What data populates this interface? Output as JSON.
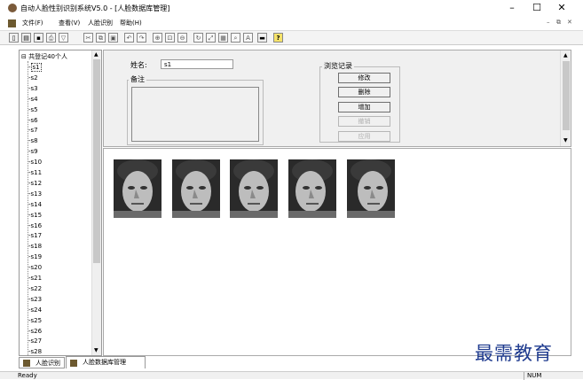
{
  "window": {
    "title": "自动人脸性别识别系统V5.0 - [人脸数据库管理]",
    "minimize": "–",
    "maximize": "☐",
    "close": "✕",
    "child_minimize": "–",
    "child_restore": "⧉",
    "child_close": "✕"
  },
  "menu": {
    "items": [
      {
        "label": "文件(F)"
      },
      {
        "label": "查看(V)"
      },
      {
        "label": "人脸识别"
      },
      {
        "label": "帮助(H)"
      }
    ]
  },
  "toolbar": {
    "icons": [
      "new-icon",
      "open-icon",
      "save-icon",
      "print-icon",
      "filter-icon",
      "cut-icon",
      "copy-icon",
      "paste-icon",
      "undo-icon",
      "redo-icon",
      "zoom-in-icon",
      "zoom-actual-icon",
      "zoom-out-icon",
      "rotate-icon",
      "fit-icon",
      "grid-icon",
      "magnify-icon",
      "text-icon",
      "image-icon",
      "help-icon"
    ],
    "help_label": "?"
  },
  "tree": {
    "root": "共登记40个人",
    "items": [
      "s1",
      "s2",
      "s3",
      "s4",
      "s5",
      "s6",
      "s7",
      "s8",
      "s9",
      "s10",
      "s11",
      "s12",
      "s13",
      "s14",
      "s15",
      "s16",
      "s17",
      "s18",
      "s19",
      "s20",
      "s21",
      "s22",
      "s23",
      "s24",
      "s25",
      "s26",
      "s27",
      "s28"
    ],
    "selected": "s1"
  },
  "form": {
    "name_label": "姓名:",
    "name_value": "s1",
    "notes_label": "备注",
    "notes_value": "",
    "browse_group_label": "浏览记录",
    "buttons": [
      {
        "label": "修改",
        "enabled": true
      },
      {
        "label": "删除",
        "enabled": true
      },
      {
        "label": "增加",
        "enabled": true
      },
      {
        "label": "撤销",
        "enabled": false
      },
      {
        "label": "应用",
        "enabled": false
      }
    ]
  },
  "faces": {
    "count": 5
  },
  "tabs": [
    {
      "label": "人脸识别",
      "active": false
    },
    {
      "label": "人脸数据库管理",
      "active": true
    }
  ],
  "status": {
    "text": "Ready",
    "num": "NUM"
  },
  "watermark": "最需教育"
}
